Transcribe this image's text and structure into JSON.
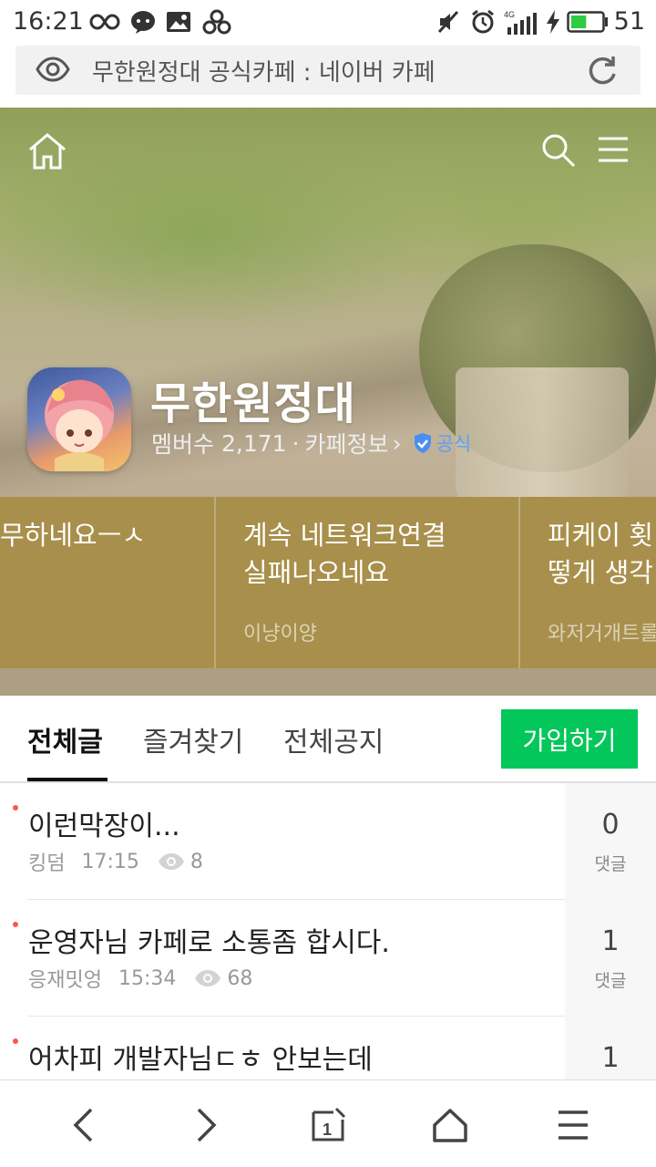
{
  "status_bar": {
    "time": "16:21",
    "network": "4G",
    "battery": "51",
    "battery_color": "#2ecc40"
  },
  "address_bar": {
    "page_title": "무한원정대 공식카페 : 네이버 카페"
  },
  "cafe": {
    "name": "무한원정대",
    "member_label": "멤버수",
    "member_count": "2,171",
    "info_link": "카페정보",
    "info_arrow": "›",
    "official_badge": "공식"
  },
  "popular_cards": [
    {
      "title": "무하네요ㅡㅅ",
      "author": ""
    },
    {
      "title": "계속 네트워크연결\n실패나오네요",
      "author": "이냥이양"
    },
    {
      "title": "피케이 횟\n떻게 생각",
      "author": "와저거개트롤"
    }
  ],
  "tabs": {
    "items": [
      {
        "label": "전체글",
        "active": true
      },
      {
        "label": "즐겨찾기",
        "active": false
      },
      {
        "label": "전체공지",
        "active": false
      }
    ],
    "join_button": "가입하기",
    "join_color": "#03c75a"
  },
  "posts": [
    {
      "title": "이런막장이...",
      "author": "킹덤",
      "time": "17:15",
      "views": "8",
      "comments": "0",
      "comment_label": "댓글",
      "is_new": true
    },
    {
      "title": "운영자님 카페로 소통좀 합시다.",
      "author": "응재밋엉",
      "time": "15:34",
      "views": "68",
      "comments": "1",
      "comment_label": "댓글",
      "is_new": true
    },
    {
      "title": "어차피 개발자님ㄷㅎ 안보는데",
      "author": "",
      "time": "",
      "views": "",
      "comments": "1",
      "comment_label": "",
      "is_new": true
    }
  ],
  "icons": {
    "home": "home-icon",
    "search": "search-icon",
    "menu": "menu-icon",
    "back": "back-arrow-icon",
    "forward": "forward-arrow-icon",
    "tabs": "tabs-icon",
    "browser_home": "browser-home-icon",
    "browser_menu": "browser-menu-icon"
  },
  "bottom_nav": {
    "tab_count": "1"
  }
}
